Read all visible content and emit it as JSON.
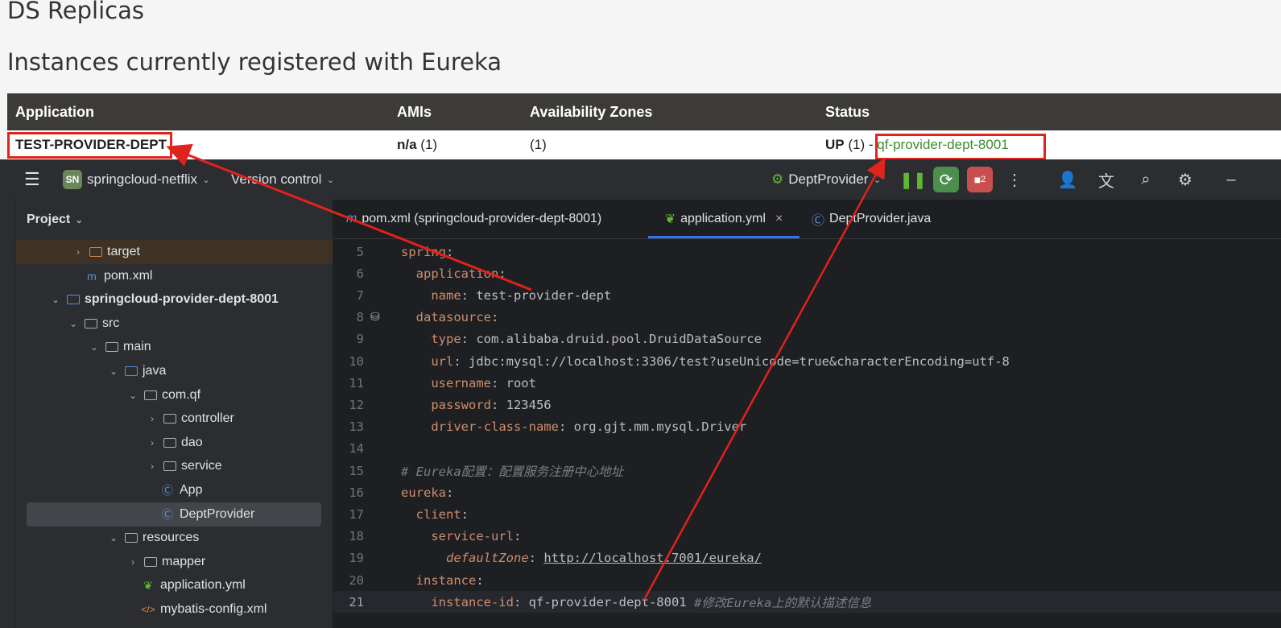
{
  "eureka": {
    "title": "DS Replicas",
    "subtitle": "Instances currently registered with Eureka",
    "columns": [
      "Application",
      "AMIs",
      "Availability Zones",
      "Status"
    ],
    "row": {
      "application": "TEST-PROVIDER-DEPT",
      "amis_label": "n/a",
      "amis_count": "(1)",
      "zones": "(1)",
      "status_label": "UP",
      "status_count": "(1) -",
      "instance_link": "qf-provider-dept-8001"
    },
    "highlight_color": "#e0231c",
    "link_color": "#3d8b2f"
  },
  "ide": {
    "project_badge": "SN",
    "project_name": "springcloud-netflix",
    "vcs_label": "Version control",
    "run_config": "DeptProvider",
    "debug_badge": "2",
    "project_panel_title": "Project",
    "tree": [
      {
        "label": "target",
        "icon": "folder-icon",
        "arrow": "›"
      },
      {
        "label": "pom.xml",
        "icon": "maven-icon",
        "arrow": ""
      },
      {
        "label": "springcloud-provider-dept-8001",
        "icon": "module-icon",
        "arrow": "⌄"
      },
      {
        "label": "src",
        "icon": "folder-icon",
        "arrow": "⌄"
      },
      {
        "label": "main",
        "icon": "folder-icon",
        "arrow": "⌄"
      },
      {
        "label": "java",
        "icon": "source-folder-icon",
        "arrow": "⌄"
      },
      {
        "label": "com.qf",
        "icon": "package-icon",
        "arrow": "⌄"
      },
      {
        "label": "controller",
        "icon": "package-icon",
        "arrow": "›"
      },
      {
        "label": "dao",
        "icon": "package-icon",
        "arrow": "›"
      },
      {
        "label": "service",
        "icon": "package-icon",
        "arrow": "›"
      },
      {
        "label": "App",
        "icon": "spring-class-icon",
        "arrow": ""
      },
      {
        "label": "DeptProvider",
        "icon": "spring-class-icon",
        "arrow": ""
      },
      {
        "label": "resources",
        "icon": "resources-folder-icon",
        "arrow": "⌄"
      },
      {
        "label": "mapper",
        "icon": "folder-icon",
        "arrow": "›"
      },
      {
        "label": "application.yml",
        "icon": "yaml-icon",
        "arrow": ""
      },
      {
        "label": "mybatis-config.xml",
        "icon": "xml-icon",
        "arrow": ""
      }
    ],
    "tabs": [
      {
        "label": "pom.xml (springcloud-provider-dept-8001)"
      },
      {
        "label": "application.yml"
      },
      {
        "label": "DeptProvider.java"
      }
    ],
    "code": [
      {
        "n": "5",
        "key": "spring",
        "rest": ":"
      },
      {
        "n": "6",
        "key": "application",
        "rest": ":"
      },
      {
        "n": "7",
        "key": "name",
        "rest": ": test-provider-dept"
      },
      {
        "n": "8",
        "key": "datasource",
        "rest": ":"
      },
      {
        "n": "9",
        "key": "type",
        "rest": ": com.alibaba.druid.pool.DruidDataSource"
      },
      {
        "n": "10",
        "key": "url",
        "rest": ": jdbc:mysql://localhost:3306/test?useUnicode=true&characterEncoding=utf-8"
      },
      {
        "n": "11",
        "key": "username",
        "rest": ": root"
      },
      {
        "n": "12",
        "key": "password",
        "rest": ": 123456"
      },
      {
        "n": "13",
        "key": "driver-class-name",
        "rest": ": org.gjt.mm.mysql.Driver"
      },
      {
        "n": "14",
        "key": "",
        "rest": ""
      },
      {
        "n": "15",
        "comment": "# Eureka配置：配置服务注册中心地址"
      },
      {
        "n": "16",
        "key": "eureka",
        "rest": ":"
      },
      {
        "n": "17",
        "key": "client",
        "rest": ":"
      },
      {
        "n": "18",
        "key": "service-url",
        "rest": ":"
      },
      {
        "n": "19",
        "key": "defaultZone",
        "rest": ": ",
        "link": "http://localhost:7001/eureka/"
      },
      {
        "n": "20",
        "key": "instance",
        "rest": ":"
      },
      {
        "n": "21",
        "key": "instance-id",
        "rest": ": qf-provider-dept-8001 ",
        "comment": "#修改Eureka上的默认描述信息"
      }
    ]
  }
}
